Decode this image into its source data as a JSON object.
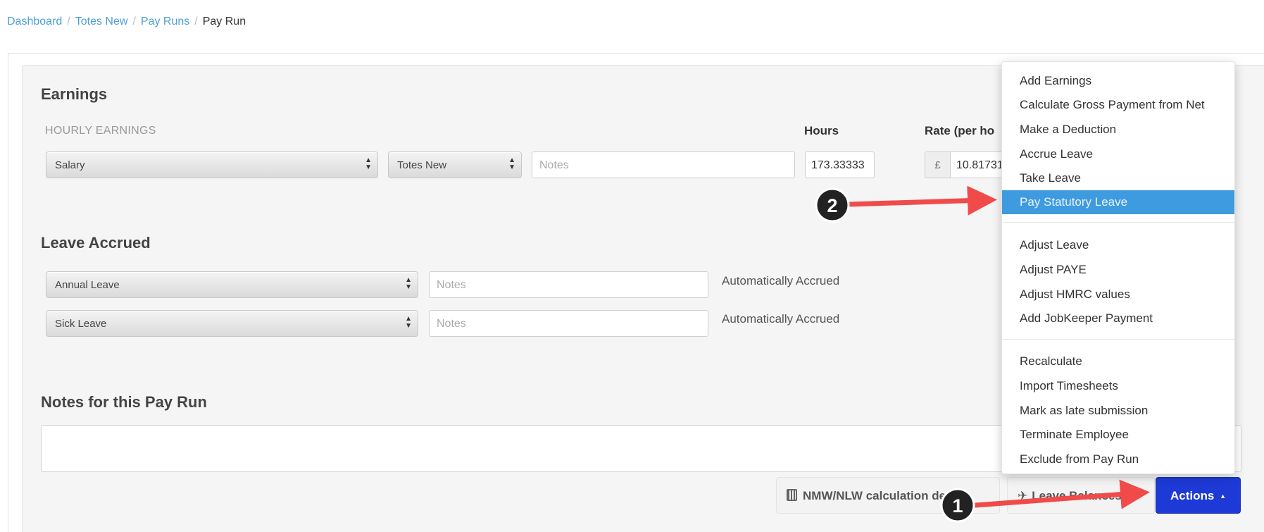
{
  "breadcrumb": {
    "items": [
      "Dashboard",
      "Totes New",
      "Pay Runs"
    ],
    "current": "Pay Run",
    "separator": "/"
  },
  "earnings": {
    "title": "Earnings",
    "hourly_label": "HOURLY EARNINGS",
    "hours_label": "Hours",
    "rate_label": "Rate (per ho",
    "category_select": "Salary",
    "location_select": "Totes New",
    "notes_placeholder": "Notes",
    "hours_value": "173.33333",
    "currency_symbol": "£",
    "rate_value": "10.81731"
  },
  "leave_accrued": {
    "title": "Leave Accrued",
    "rows": [
      {
        "type": "Annual Leave",
        "notes_placeholder": "Notes",
        "status": "Automatically Accrued"
      },
      {
        "type": "Sick Leave",
        "notes_placeholder": "Notes",
        "status": "Automatically Accrued"
      }
    ]
  },
  "notes_section": {
    "title": "Notes for this Pay Run"
  },
  "buttons": {
    "nmw": "NMW/NLW calculation details",
    "leave_balances": "Leave Balances",
    "actions": "Actions",
    "actions_caret": "▲"
  },
  "actions_menu": {
    "group1": [
      "Add Earnings",
      "Calculate Gross Payment from Net",
      "Make a Deduction",
      "Accrue Leave",
      "Take Leave",
      "Pay Statutory Leave"
    ],
    "group2": [
      "Adjust Leave",
      "Adjust PAYE",
      "Adjust HMRC values",
      "Add JobKeeper Payment"
    ],
    "group3": [
      "Recalculate",
      "Import Timesheets",
      "Mark as late submission",
      "Terminate Employee",
      "Exclude from Pay Run"
    ],
    "highlighted": "Pay Statutory Leave"
  },
  "annotations": {
    "step1": "1",
    "step2": "2",
    "arrow_color": "#f04a4a",
    "marker_color": "#222222"
  },
  "colors": {
    "link": "#4a9fd4",
    "primary_button": "#1e3ad6",
    "menu_highlight": "#3f9be0"
  }
}
